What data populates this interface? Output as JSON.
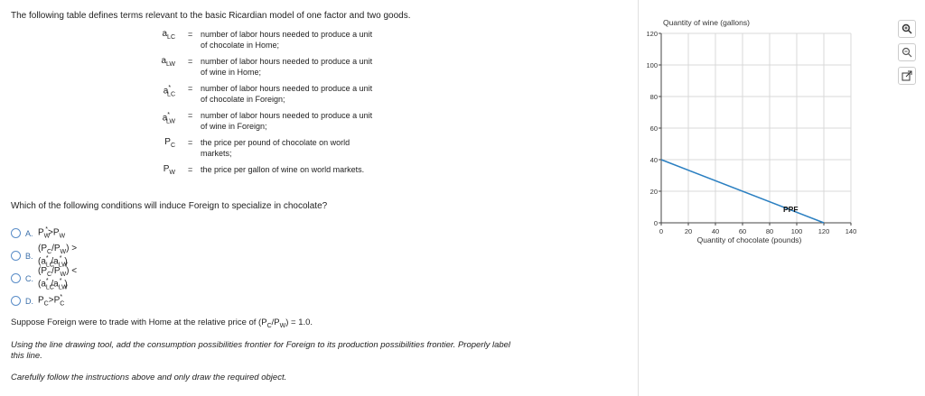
{
  "intro": "The following table defines terms relevant to the basic Ricardian model of one factor and two goods.",
  "definitions": [
    {
      "sym_main": "a",
      "sym_sub": "LC",
      "sym_star": "",
      "desc": "number of labor hours needed to produce a unit of chocolate in Home;"
    },
    {
      "sym_main": "a",
      "sym_sub": "LW",
      "sym_star": "",
      "desc": "number of labor hours needed to produce a unit of wine in Home;"
    },
    {
      "sym_main": "a",
      "sym_sub": "LC",
      "sym_star": "*",
      "desc": "number of labor hours needed to produce a unit of chocolate in Foreign;"
    },
    {
      "sym_main": "a",
      "sym_sub": "LW",
      "sym_star": "*",
      "desc": "number of labor hours needed to produce a unit of wine in Foreign;"
    },
    {
      "sym_main": "P",
      "sym_sub": "C",
      "sym_star": "",
      "desc": "the price per pound of chocolate on world markets;"
    },
    {
      "sym_main": "P",
      "sym_sub": "W",
      "sym_star": "",
      "desc": "the price per gallon of wine on world markets."
    }
  ],
  "eq_sign": "=",
  "question": "Which of the following conditions will induce Foreign to specialize in chocolate?",
  "options": [
    {
      "letter": "A.",
      "expr": "P*W>PW"
    },
    {
      "letter": "B.",
      "expr": "(PC/PW) > (a*LC/a*LW)"
    },
    {
      "letter": "C.",
      "expr": "(PC/PW) < (a*LC/a*LW)"
    },
    {
      "letter": "D.",
      "expr": "PC>P*C"
    }
  ],
  "p1": "Suppose Foreign were to trade with Home at the relative price of (PC/PW) = 1.0.",
  "p2": "Using the line drawing tool, add the consumption possibilities frontier for Foreign to its production possibilities frontier. Properly label this line.",
  "p3": "Carefully follow the instructions above and only draw the required object.",
  "chart_data": {
    "type": "line",
    "ylabel": "Quantity of wine (gallons)",
    "xlabel": "Quantity of chocolate (pounds)",
    "xlim": [
      0,
      140
    ],
    "ylim": [
      0,
      120
    ],
    "xticks": [
      "0",
      "20",
      "40",
      "60",
      "80",
      "100",
      "120",
      "140"
    ],
    "yticks": [
      "0",
      "20",
      "40",
      "60",
      "80",
      "100",
      "120"
    ],
    "grid": true,
    "series": [
      {
        "name": "PPF",
        "x": [
          0,
          120
        ],
        "y": [
          40,
          0
        ],
        "color": "#2a7fc1"
      }
    ],
    "annotations": [
      {
        "text": "PPF",
        "x": 90,
        "y": 7
      }
    ]
  },
  "tools": [
    "zoom-in-icon",
    "zoom-out-icon",
    "popout-icon"
  ]
}
